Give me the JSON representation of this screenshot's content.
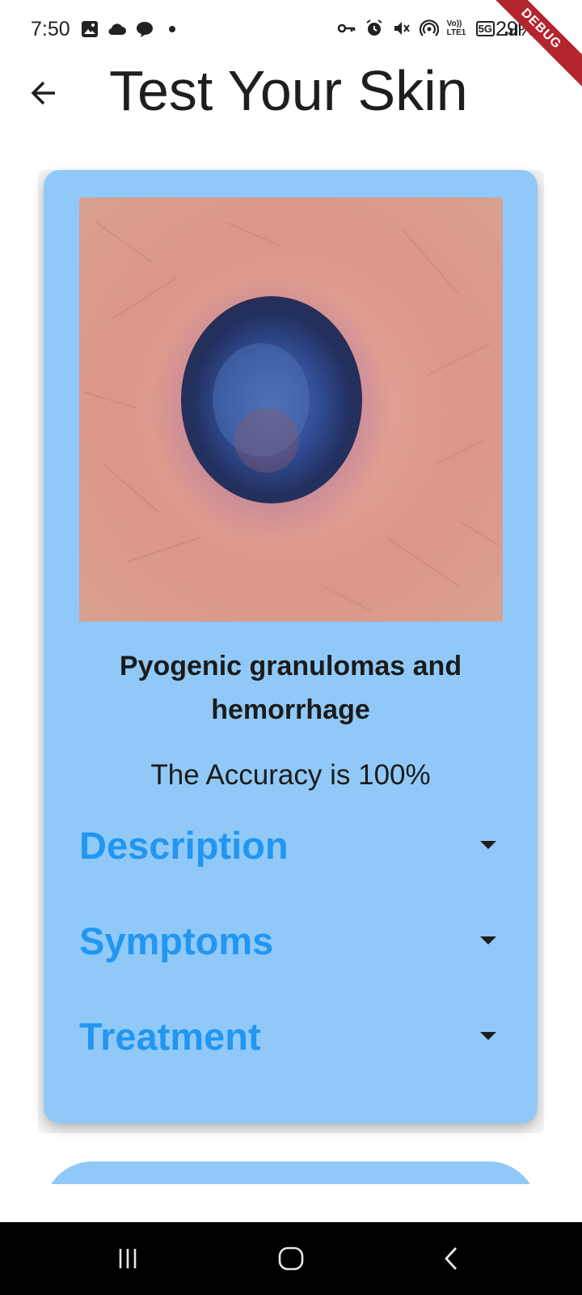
{
  "status_bar": {
    "time": "7:50",
    "network_type": "5G",
    "volte_label": "Vo)) LTE1",
    "battery": "29%",
    "left_icons": [
      "image-icon",
      "cloud-icon",
      "chat-icon",
      "dot-icon"
    ],
    "right_icons": [
      "key-icon",
      "alarm-icon",
      "mute-icon",
      "hotspot-icon",
      "volte-icon",
      "5g-icon",
      "signal-icon"
    ]
  },
  "debug_banner": "DEBUG",
  "app_bar": {
    "title": "Test Your Skin",
    "back_icon": "arrow-left-icon"
  },
  "result_card": {
    "background_color": "#90c9f7",
    "diagnosis": "Pyogenic granulomas and hemorrhage",
    "accuracy_text": "The Accuracy is 100%",
    "sections": [
      {
        "title": "Description",
        "icon": "caret-down-icon"
      },
      {
        "title": "Symptoms",
        "icon": "caret-down-icon"
      },
      {
        "title": "Treatment",
        "icon": "caret-down-icon"
      }
    ],
    "section_title_color": "#2196f3"
  },
  "nav_bar": {
    "buttons": [
      "recent-apps-icon",
      "home-icon",
      "back-icon"
    ]
  }
}
